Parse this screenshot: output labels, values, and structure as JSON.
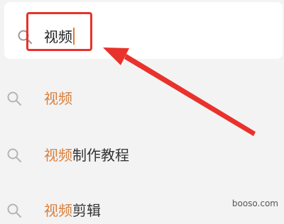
{
  "search": {
    "query": "视频"
  },
  "suggestions": [
    {
      "highlight": "视频",
      "rest": ""
    },
    {
      "highlight": "视频",
      "rest": "制作教程"
    },
    {
      "highlight": "视频",
      "rest": "剪辑"
    }
  ],
  "colors": {
    "highlight_text": "#d97e3a",
    "annotation_red": "#e8322b",
    "background": "#f3f3f3"
  },
  "icons": [
    "search-icon",
    "arrow-annotation"
  ],
  "watermark": "booso.com"
}
